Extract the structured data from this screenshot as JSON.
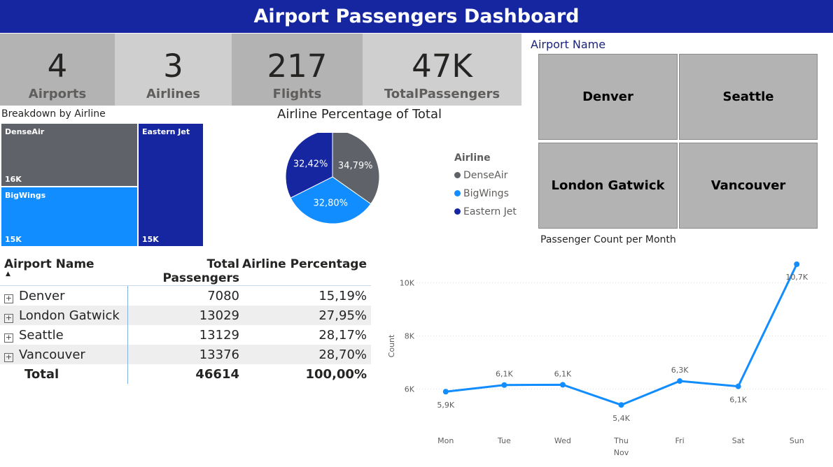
{
  "header": {
    "title": "Airport Passengers Dashboard"
  },
  "kpis": [
    {
      "value": "4",
      "label": "Airports"
    },
    {
      "value": "3",
      "label": "Airlines"
    },
    {
      "value": "217",
      "label": "Flights"
    },
    {
      "value": "47K",
      "label": "TotalPassengers"
    }
  ],
  "treemap": {
    "title": "Breakdown by Airline",
    "cells": [
      {
        "name": "DenseAir",
        "value": "16K",
        "color": "#5f6369"
      },
      {
        "name": "BigWings",
        "value": "15K",
        "color": "#118dff"
      },
      {
        "name": "Eastern Jet",
        "value": "15K",
        "color": "#1526a0"
      }
    ]
  },
  "slicer": {
    "title": "Airport Name",
    "options": [
      "Denver",
      "Seattle",
      "London Gatwick",
      "Vancouver"
    ]
  },
  "pie": {
    "title": "Airline Percentage of Total",
    "legend_title": "Airline",
    "slices": [
      {
        "name": "DenseAir",
        "label": "34,79%",
        "value": 34.79,
        "color": "#5f6369"
      },
      {
        "name": "BigWings",
        "label": "32,80%",
        "value": 32.8,
        "color": "#118dff"
      },
      {
        "name": "Eastern Jet",
        "label": "32,42%",
        "value": 32.42,
        "color": "#1526a0"
      }
    ]
  },
  "table": {
    "columns": [
      "Airport Name",
      "Total Passengers",
      "Airline Percentage"
    ],
    "rows": [
      {
        "name": "Denver",
        "passengers": "7080",
        "pct": "15,19%"
      },
      {
        "name": "London Gatwick",
        "passengers": "13029",
        "pct": "27,95%"
      },
      {
        "name": "Seattle",
        "passengers": "13129",
        "pct": "28,17%"
      },
      {
        "name": "Vancouver",
        "passengers": "13376",
        "pct": "28,70%"
      }
    ],
    "total": {
      "name": "Total",
      "passengers": "46614",
      "pct": "100,00%"
    }
  },
  "chart_data": {
    "type": "line",
    "title": "Passenger Count per Month",
    "ylabel": "Count",
    "x": [
      "Mon",
      "Tue",
      "Wed",
      "Thu",
      "Fri",
      "Sat",
      "Sun"
    ],
    "x_group_label": "Nov",
    "values": [
      5900,
      6150,
      6160,
      5400,
      6300,
      6100,
      10700
    ],
    "data_labels": [
      "5,9K",
      "6,1K",
      "6,1K",
      "5,4K",
      "6,3K",
      "6,1K",
      "10,7K"
    ],
    "y_ticks": [
      {
        "value": 6000,
        "label": "6K"
      },
      {
        "value": 8000,
        "label": "8K"
      },
      {
        "value": 10000,
        "label": "10K"
      }
    ],
    "ylim": [
      4800,
      10700
    ],
    "color": "#118dff",
    "grid": true
  }
}
